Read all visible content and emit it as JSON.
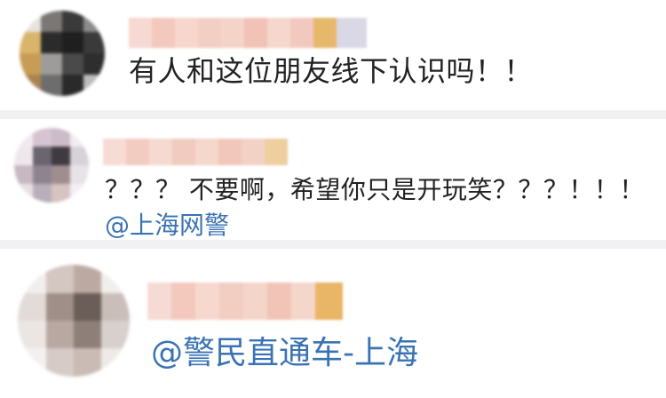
{
  "comments": [
    {
      "text": "有人和这位朋友线下认识吗！！",
      "mention": ""
    },
    {
      "text": "？？？ 不要啊，希望你只是开玩笑？？？！！！",
      "mention": "@上海网警"
    },
    {
      "text": "",
      "mention": "@警民直通车-上海"
    }
  ],
  "colors": {
    "mention": "#3a73b3",
    "text": "#222222",
    "divider": "#f1f1f3"
  },
  "icons": {
    "avatar": "pixelated-avatar",
    "username": "pixelated-username"
  }
}
